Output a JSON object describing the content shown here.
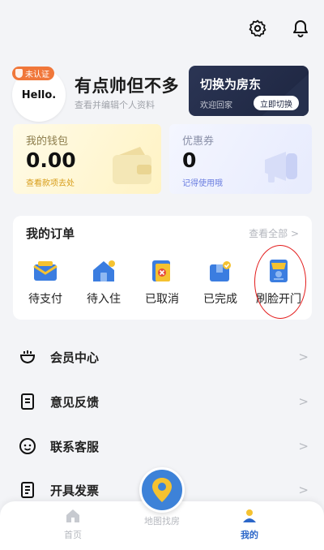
{
  "header": {
    "settings_icon": "gear-icon",
    "notifications_icon": "bell-icon"
  },
  "profile": {
    "badge": "未认证",
    "avatar_text": "Hello.",
    "nickname": "有点帅但不多",
    "subtitle": "查看并编辑个人资料"
  },
  "switch_card": {
    "title": "切换为房东",
    "subtitle": "欢迎回家",
    "button": "立即切换"
  },
  "wallet": {
    "label": "我的钱包",
    "value": "0.00",
    "link": "查看款项去处"
  },
  "coupon": {
    "label": "优惠券",
    "value": "0",
    "link": "记得使用哦"
  },
  "orders": {
    "title": "我的订单",
    "view_all": "查看全部 >",
    "items": [
      {
        "label": "待支付",
        "icon": "wallet-envelope-icon"
      },
      {
        "label": "待入住",
        "icon": "house-icon"
      },
      {
        "label": "已取消",
        "icon": "cancelled-doc-icon"
      },
      {
        "label": "已完成",
        "icon": "completed-box-icon"
      },
      {
        "label": "刷脸开门",
        "icon": "face-door-icon"
      }
    ]
  },
  "menu": [
    {
      "label": "会员中心",
      "icon": "member-icon"
    },
    {
      "label": "意见反馈",
      "icon": "feedback-icon"
    },
    {
      "label": "联系客服",
      "icon": "service-icon"
    },
    {
      "label": "开具发票",
      "icon": "invoice-icon"
    }
  ],
  "bottom_nav": {
    "home": "首页",
    "map": "地图找房",
    "mine": "我的"
  },
  "colors": {
    "accent": "#2c67c9",
    "badge": "#f0773a",
    "dark_card": "#1d2540",
    "highlight": "#e31b1b"
  }
}
